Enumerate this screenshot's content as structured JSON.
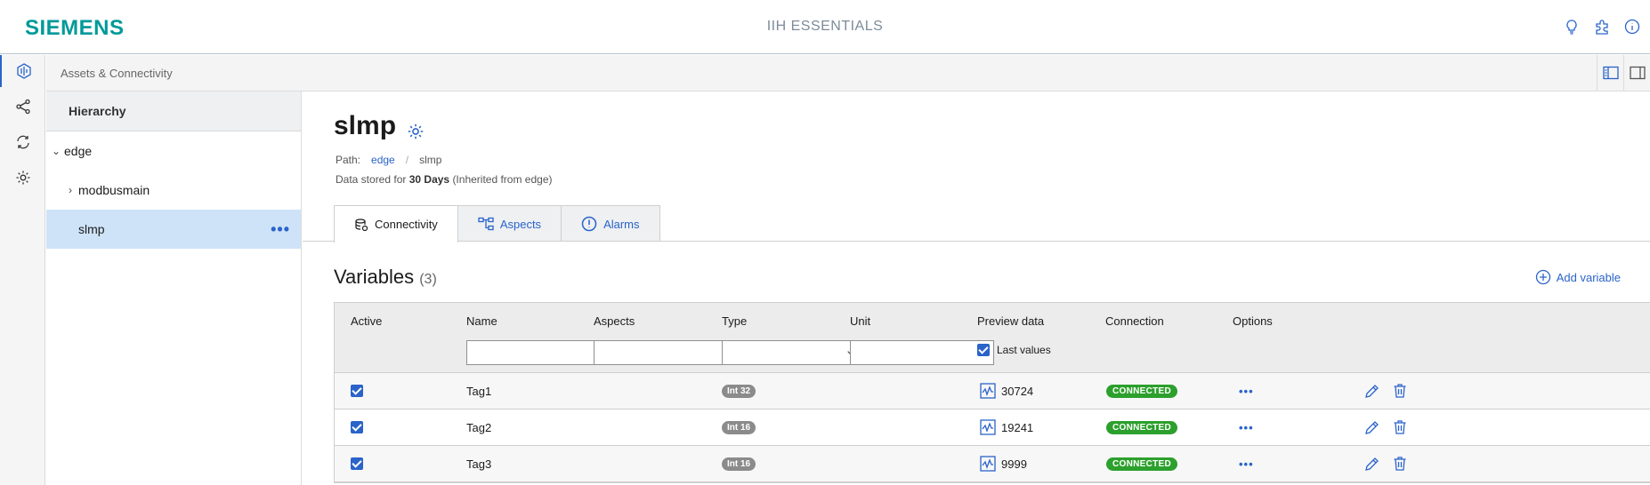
{
  "header": {
    "brand": "SIEMENS",
    "app_title": "IIH ESSENTIALS"
  },
  "subheader": {
    "breadcrumb": "Assets & Connectivity"
  },
  "hierarchy": {
    "title": "Hierarchy",
    "nodes": [
      {
        "label": "edge",
        "expanded": true
      },
      {
        "label": "modbusmain",
        "expanded": false
      },
      {
        "label": "slmp",
        "selected": true
      }
    ]
  },
  "asset": {
    "name": "slmp",
    "path_label": "Path:",
    "path": [
      "edge",
      "slmp"
    ],
    "retention_prefix": "Data stored for",
    "retention_value": "30 Days",
    "retention_suffix": "(Inherited from edge)"
  },
  "tabs": [
    {
      "label": "Connectivity",
      "active": true
    },
    {
      "label": "Aspects",
      "active": false
    },
    {
      "label": "Alarms",
      "active": false
    }
  ],
  "variables": {
    "title": "Variables",
    "count": "(3)",
    "add_label": "Add variable",
    "columns": [
      "Active",
      "Name",
      "Aspects",
      "Type",
      "Unit",
      "Preview data",
      "Connection",
      "Options"
    ],
    "last_values_label": "Last values",
    "last_values_checked": true,
    "rows": [
      {
        "active": true,
        "name": "Tag1",
        "type": "Int 32",
        "preview": "30724",
        "connection": "CONNECTED"
      },
      {
        "active": true,
        "name": "Tag2",
        "type": "Int 16",
        "preview": "19241",
        "connection": "CONNECTED"
      },
      {
        "active": true,
        "name": "Tag3",
        "type": "Int 16",
        "preview": "9999",
        "connection": "CONNECTED"
      }
    ]
  },
  "colors": {
    "accent": "#2a63c9",
    "brand": "#009999",
    "connected": "#2ca02c",
    "selected_bg": "#cfe3f8"
  }
}
